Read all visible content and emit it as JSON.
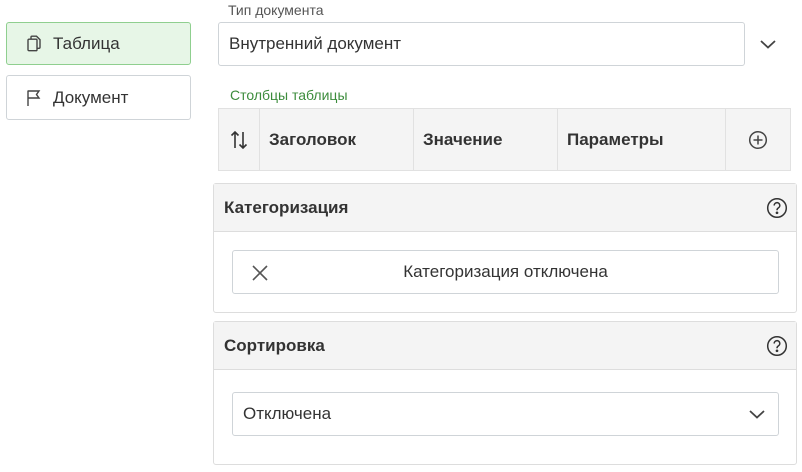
{
  "nav": {
    "table_label": "Таблица",
    "document_label": "Документ"
  },
  "doc_type": {
    "label": "Тип документа",
    "value": "Внутренний документ"
  },
  "columns": {
    "label": "Столбцы таблицы",
    "headers": [
      "Заголовок",
      "Значение",
      "Параметры"
    ]
  },
  "categorization": {
    "title": "Категоризация",
    "value": "Категоризация отключена"
  },
  "sorting": {
    "title": "Сортировка",
    "value": "Отключена"
  },
  "colors": {
    "active_bg": "#e7f6e7",
    "active_border": "#8fcf8f",
    "green_label": "#3c8c3c"
  },
  "icons": [
    "copy-icon",
    "flag-icon",
    "chevron-down-icon",
    "sort-icon",
    "add-column-icon",
    "help-icon",
    "close-icon"
  ]
}
